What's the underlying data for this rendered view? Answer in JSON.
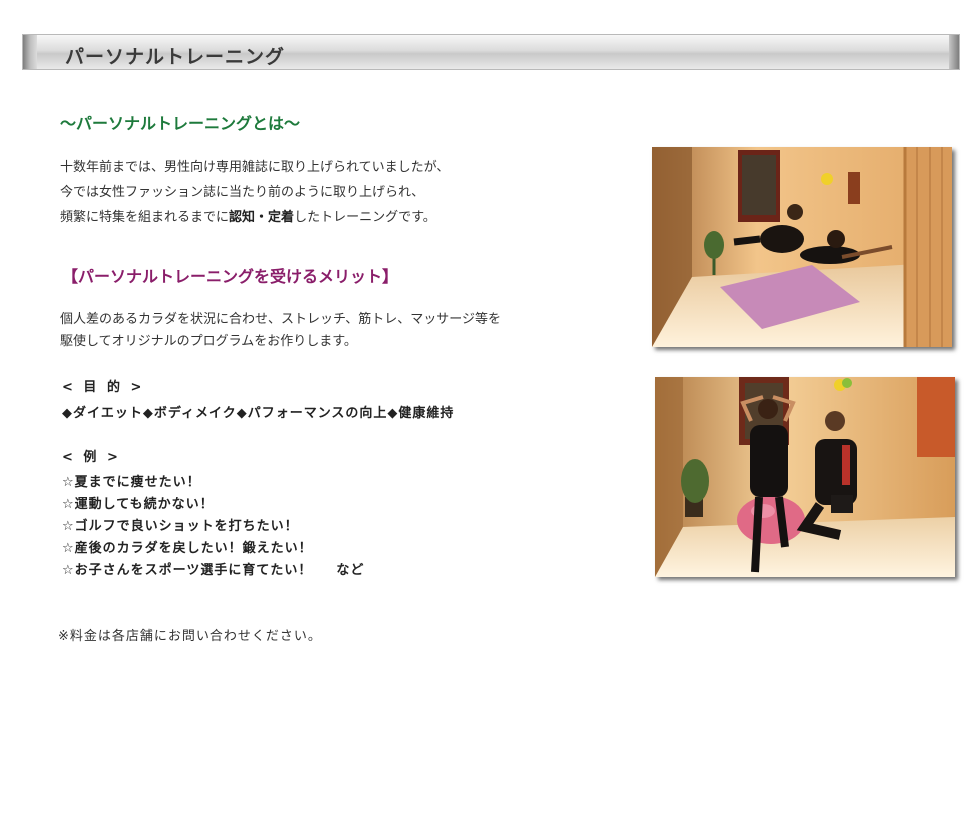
{
  "header": {
    "title": "パーソナルトレーニング"
  },
  "about": {
    "heading": "～パーソナルトレーニングとは～",
    "line1": "十数年前までは、男性向け専用雑誌に取り上げられていましたが、",
    "line2": "今では女性ファッション誌に当たり前のように取り上げられ、",
    "line3_pre": "頻繁に特集を組まれるまでに",
    "line3_bold1": "認知",
    "line3_sep": "・",
    "line3_bold2": "定着",
    "line3_post": "したトレーニングです。"
  },
  "merit": {
    "heading": "【パーソナルトレーニングを受けるメリット】",
    "line1": "個人差のあるカラダを状況に合わせ、ストレッチ、筋トレ、マッサージ等を",
    "line2": "駆使してオリジナルのプログラムをお作りします。"
  },
  "purpose": {
    "label": "< 目 的 >",
    "items": "◆ダイエット◆ボディメイク◆パフォーマンスの向上◆健康維持"
  },
  "examples": {
    "label": "< 例 >",
    "items": [
      "☆夏までに痩せたい！",
      "☆運動しても続かない！",
      "☆ゴルフで良いショットを打ちたい！",
      "☆産後のカラダを戻したい！鍛えたい！",
      "☆お子さんをスポーツ選手に育てたい！"
    ],
    "suffix": "など"
  },
  "note": "※料金は各店舗にお問い合わせください。",
  "colors": {
    "green_heading": "#1e7a3c",
    "purple_heading": "#8a1e6a"
  }
}
